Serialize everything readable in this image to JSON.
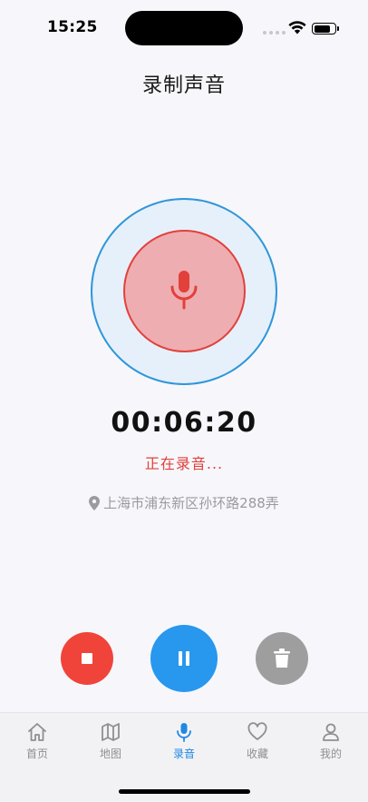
{
  "status_bar": {
    "time": "15:25",
    "battery_level": 0.85
  },
  "header": {
    "title": "录制声音"
  },
  "recorder": {
    "timer": "00:06:20",
    "status": "正在录音...",
    "location": "上海市浦东新区孙环路288弄",
    "icons": {
      "center": "microphone-icon",
      "location": "map-pin-icon"
    },
    "colors": {
      "recording": "#e2403b",
      "ring": "#2f97d8",
      "pause": "#2897ee",
      "stop": "#f0443a",
      "delete": "#9e9e9e"
    }
  },
  "controls": {
    "stop": "stop-icon",
    "pause": "pause-icon",
    "delete": "trash-icon"
  },
  "tab_bar": {
    "items": [
      {
        "label": "首页",
        "icon": "home-icon"
      },
      {
        "label": "地图",
        "icon": "map-icon"
      },
      {
        "label": "录音",
        "icon": "microphone-icon",
        "active": true
      },
      {
        "label": "收藏",
        "icon": "heart-icon"
      },
      {
        "label": "我的",
        "icon": "user-icon"
      }
    ],
    "active_color": "#1f88e5"
  }
}
